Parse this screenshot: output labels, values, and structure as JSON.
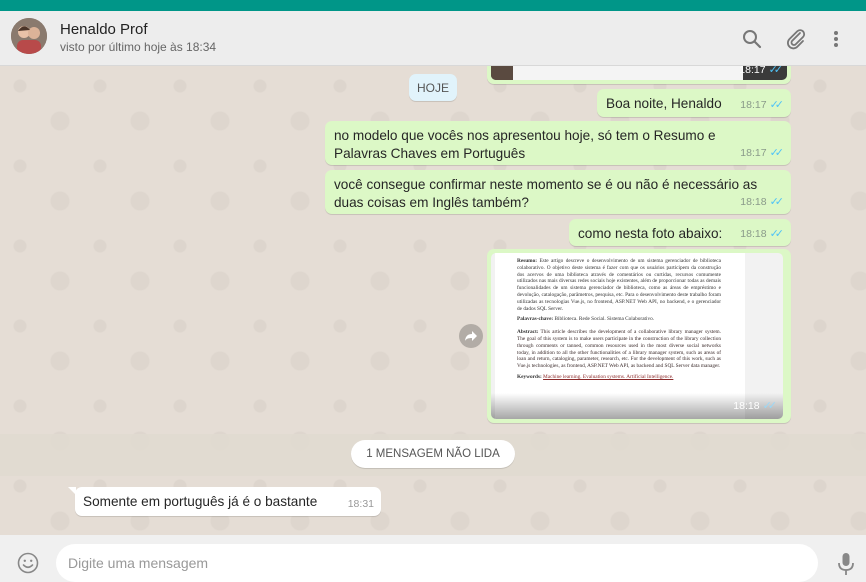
{
  "header": {
    "contact_name": "Henaldo Prof",
    "status": "visto por último hoje às 18:34",
    "icons": [
      "search-icon",
      "attach-icon",
      "menu-icon"
    ]
  },
  "chat": {
    "top_image_time": "18:17",
    "date_chip": "HOJE",
    "messages": [
      {
        "text": "Boa noite, Henaldo",
        "time": "18:17"
      },
      {
        "text": "no modelo que vocês nos apresentou hoje, só tem o Resumo e Palavras Chaves em Português",
        "time": "18:17"
      },
      {
        "text": "você consegue confirmar neste momento se é ou não é necessário as duas coisas em Inglês também?",
        "time": "18:18"
      },
      {
        "text": "como nesta foto abaixo:",
        "time": "18:18"
      }
    ],
    "photo": {
      "time": "18:18",
      "doc": {
        "resumo_label": "Resumo:",
        "resumo": "Este artigo descreve o desenvolvimento de um sistema gerenciador de biblioteca colaborativo. O objetivo deste sistema é fazer com que os usuários participem da construção dos acervos de uma biblioteca através de comentários ou curtidas, recursos comumente utilizados nas mais diversas redes sociais hoje existentes, além de proporcionar todas as demais funcionalidades de um sistema gerenciador de biblioteca, como as áreas de empréstimo e devolução, catalogação, parâmetros, pesquisa, etc. Para o desenvolvimento deste trabalho foram utilizadas as tecnologias Vue.js, no frontend, ASP.NET Web API, no backend, e o gerenciador de dados SQL Server.",
        "palavras_label": "Palavras-chave:",
        "palavras": "Biblioteca. Rede Social. Sistema Colaborativo.",
        "abstract_label": "Abstract:",
        "abstract": "This article describes the development of a collaborative library manager system. The goal of this system is to make users participate in the construction of the library collection through comments or tanned, common resources used in the most diverse social networks today, in addition to all the other functionalities of a library manager system, such as areas of loan and return, cataloging, parameter, research, etc. For the development of this work, such as Vue.js technologies, as frontend, ASP.NET Web API, as backend and SQL Server data manager.",
        "keywords_label": "Keywords:",
        "keywords": "Machine learning. Evaluation systems. Artificial Intelligence."
      }
    },
    "unread_label": "1 MENSAGEM NÃO LIDA",
    "incoming": {
      "text": "Somente em português já é o bastante",
      "time": "18:31"
    }
  },
  "footer": {
    "placeholder": "Digite uma mensagem"
  },
  "colors": {
    "accent": "#009688",
    "bubble_out": "#dcf8c6",
    "bubble_in": "#ffffff",
    "ticks": "#4fc3f7"
  }
}
